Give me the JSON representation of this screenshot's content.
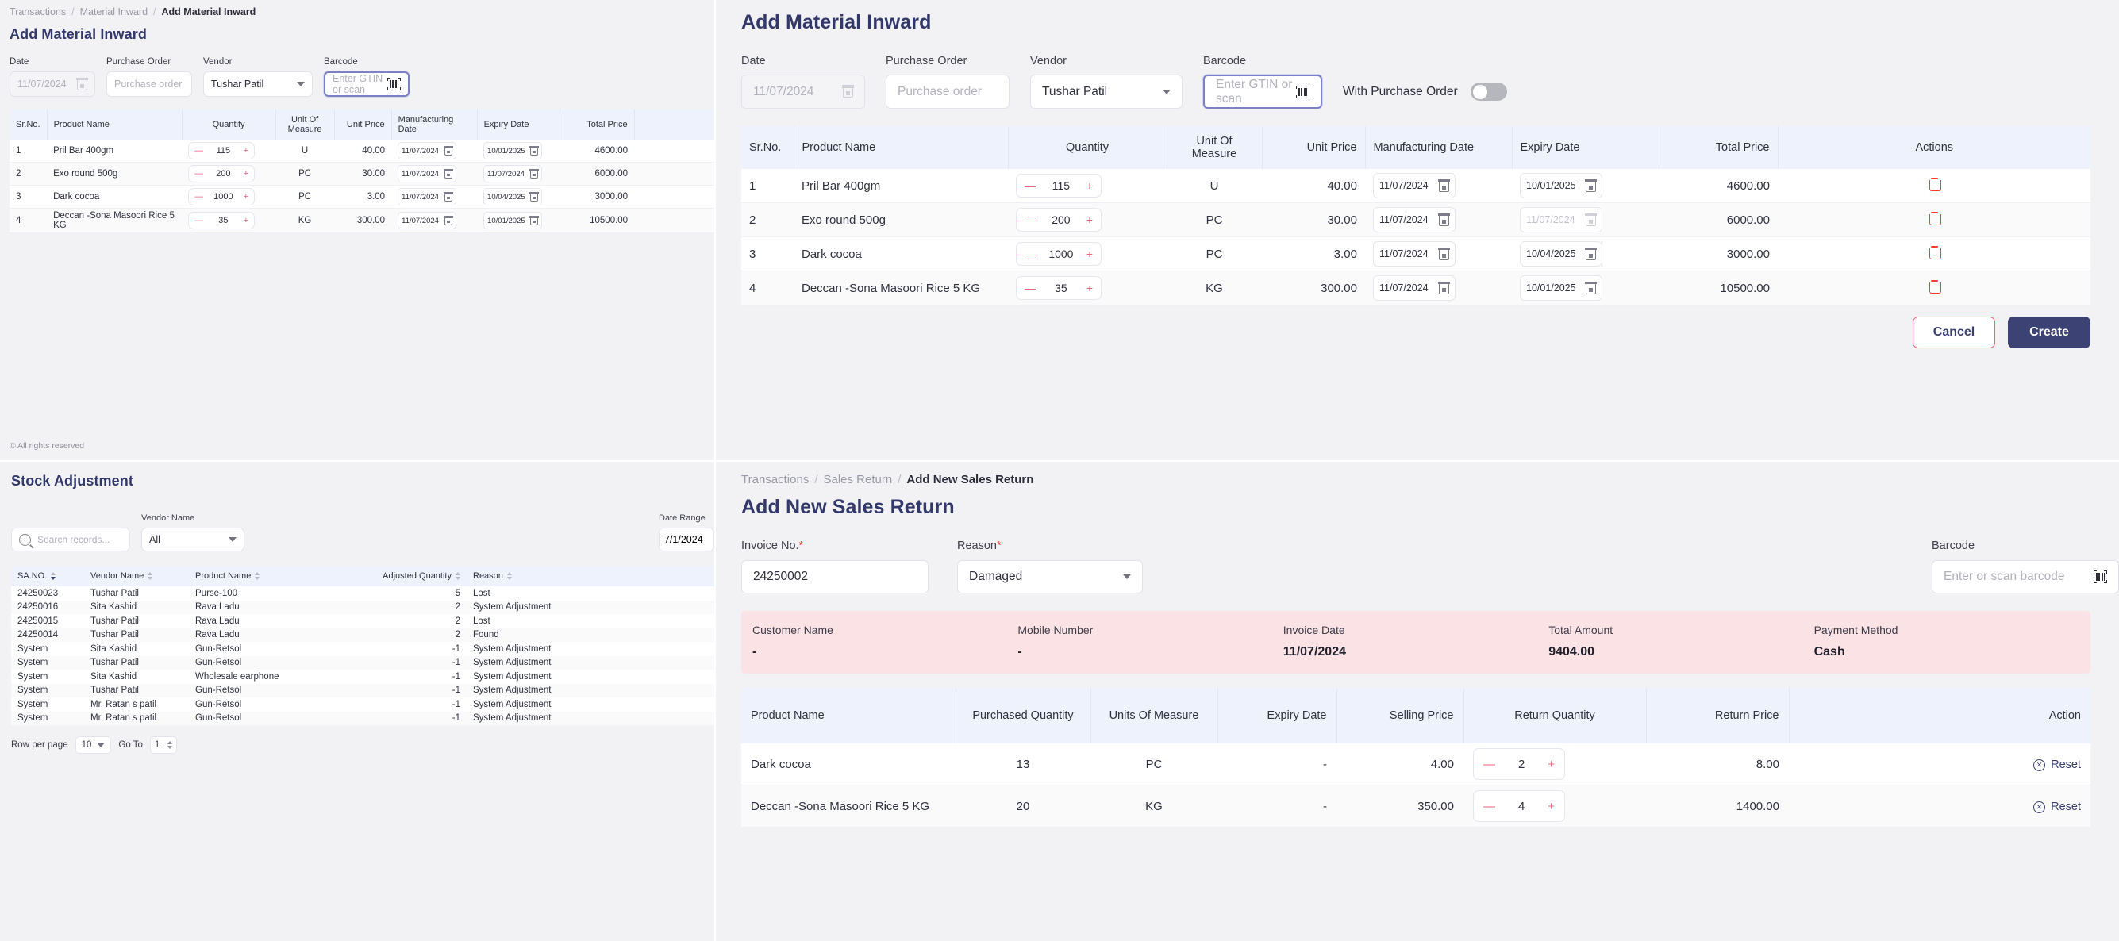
{
  "colors": {
    "title": "#33386b",
    "accent_red": "#f4607a",
    "table_header_bg": "#eef2fd",
    "pink_panel": "#fbe2e5",
    "primary_button": "#3d4274"
  },
  "material_inward": {
    "breadcrumb": [
      "Transactions",
      "Material Inward",
      "Add Material Inward"
    ],
    "title": "Add Material Inward",
    "fields": {
      "date_label": "Date",
      "date_placeholder": "11/07/2024",
      "purchase_order_label": "Purchase Order",
      "purchase_order_placeholder": "Purchase order",
      "vendor_label": "Vendor",
      "vendor_value": "Tushar Patil",
      "barcode_label": "Barcode",
      "barcode_placeholder": "Enter GTIN or scan",
      "with_po_label": "With Purchase Order",
      "with_po_on": false
    },
    "columns": [
      "Sr.No.",
      "Product Name",
      "Quantity",
      "Unit Of Measure",
      "Unit Price",
      "Manufacturing Date",
      "Expiry Date",
      "Total Price",
      "Actions"
    ],
    "rows": [
      {
        "sr": "1",
        "product": "Pril Bar 400gm",
        "qty": "115",
        "uom": "U",
        "unit_price": "40.00",
        "mfg_date": "11/07/2024",
        "exp_date": "10/01/2025",
        "exp_disabled": false,
        "total": "4600.00"
      },
      {
        "sr": "2",
        "product": "Exo round 500g",
        "qty": "200",
        "uom": "PC",
        "unit_price": "30.00",
        "mfg_date": "11/07/2024",
        "exp_date": "11/07/2024",
        "exp_disabled": true,
        "total": "6000.00"
      },
      {
        "sr": "3",
        "product": "Dark cocoa",
        "qty": "1000",
        "uom": "PC",
        "unit_price": "3.00",
        "mfg_date": "11/07/2024",
        "exp_date": "10/04/2025",
        "exp_disabled": false,
        "total": "3000.00"
      },
      {
        "sr": "4",
        "product": "Deccan -Sona Masoori Rice 5 KG",
        "qty": "35",
        "uom": "KG",
        "unit_price": "300.00",
        "mfg_date": "11/07/2024",
        "exp_date": "10/01/2025",
        "exp_disabled": false,
        "total": "10500.00"
      }
    ],
    "buttons": {
      "cancel": "Cancel",
      "create": "Create"
    },
    "copyright": "© All rights reserved"
  },
  "stock_adjustment": {
    "title": "Stock Adjustment",
    "search_placeholder": "Search records...",
    "vendor_label": "Vendor Name",
    "vendor_value": "All",
    "date_range_label": "Date Range",
    "date_range_value": "7/1/2024",
    "columns": [
      "SA.NO.",
      "Vendor Name",
      "Product Name",
      "Adjusted Quantity",
      "Reason"
    ],
    "rows": [
      {
        "sa_no": "24250023",
        "vendor": "Tushar Patil",
        "product": "Purse-100",
        "qty": "5",
        "reason": "Lost"
      },
      {
        "sa_no": "24250016",
        "vendor": "Sita Kashid",
        "product": "Rava Ladu",
        "qty": "2",
        "reason": "System Adjustment"
      },
      {
        "sa_no": "24250015",
        "vendor": "Tushar Patil",
        "product": "Rava Ladu",
        "qty": "2",
        "reason": "Lost"
      },
      {
        "sa_no": "24250014",
        "vendor": "Tushar Patil",
        "product": "Rava Ladu",
        "qty": "2",
        "reason": "Found"
      },
      {
        "sa_no": "System",
        "vendor": "Sita Kashid",
        "product": "Gun-Retsol",
        "qty": "-1",
        "reason": "System Adjustment"
      },
      {
        "sa_no": "System",
        "vendor": "Tushar Patil",
        "product": "Gun-Retsol",
        "qty": "-1",
        "reason": "System Adjustment"
      },
      {
        "sa_no": "System",
        "vendor": "Sita Kashid",
        "product": "Wholesale earphone",
        "qty": "-1",
        "reason": "System Adjustment"
      },
      {
        "sa_no": "System",
        "vendor": "Tushar Patil",
        "product": "Gun-Retsol",
        "qty": "-1",
        "reason": "System Adjustment"
      },
      {
        "sa_no": "System",
        "vendor": "Mr. Ratan s patil",
        "product": "Gun-Retsol",
        "qty": "-1",
        "reason": "System Adjustment"
      },
      {
        "sa_no": "System",
        "vendor": "Mr. Ratan s patil",
        "product": "Gun-Retsol",
        "qty": "-1",
        "reason": "System Adjustment"
      }
    ],
    "pager": {
      "rows_label": "Row per page",
      "rows_value": "10",
      "goto_label": "Go To",
      "goto_value": "1"
    }
  },
  "sales_return": {
    "breadcrumb": [
      "Transactions",
      "Sales Return",
      "Add New Sales Return"
    ],
    "title": "Add New Sales Return",
    "fields": {
      "invoice_label": "Invoice No.",
      "invoice_value": "24250002",
      "reason_label": "Reason",
      "reason_value": "Damaged",
      "barcode_label": "Barcode",
      "barcode_placeholder": "Enter or scan barcode"
    },
    "summary": [
      {
        "label": "Customer Name",
        "value": "-"
      },
      {
        "label": "Mobile Number",
        "value": "-"
      },
      {
        "label": "Invoice Date",
        "value": "11/07/2024"
      },
      {
        "label": "Total Amount",
        "value": "9404.00"
      },
      {
        "label": "Payment Method",
        "value": "Cash"
      }
    ],
    "columns": [
      "Product Name",
      "Purchased Quantity",
      "Units Of Measure",
      "Expiry Date",
      "Selling Price",
      "Return Quantity",
      "Return Price",
      "Action"
    ],
    "rows": [
      {
        "product": "Dark cocoa",
        "purchased": "13",
        "uom": "PC",
        "expiry": "-",
        "selling": "4.00",
        "return_qty": "2",
        "return_price": "8.00",
        "action": "Reset"
      },
      {
        "product": "Deccan -Sona Masoori Rice 5 KG",
        "purchased": "20",
        "uom": "KG",
        "expiry": "-",
        "selling": "350.00",
        "return_qty": "4",
        "return_price": "1400.00",
        "action": "Reset"
      }
    ]
  }
}
